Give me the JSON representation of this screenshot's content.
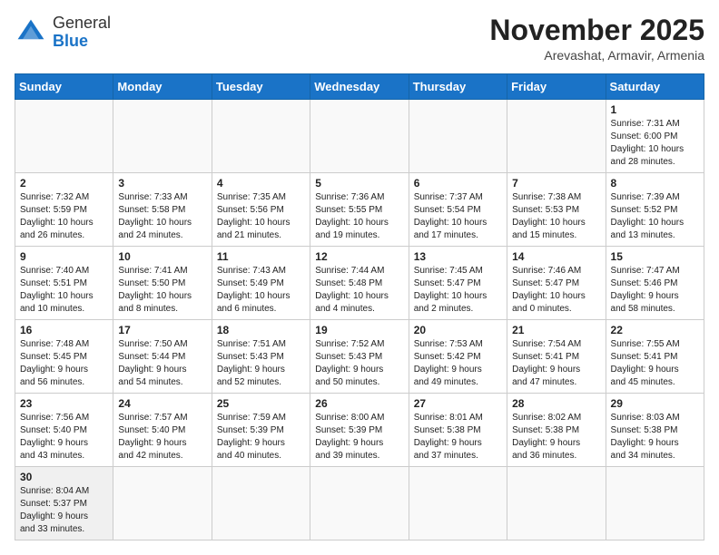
{
  "logo": {
    "text_general": "General",
    "text_blue": "Blue"
  },
  "title": "November 2025",
  "subtitle": "Arevashat, Armavir, Armenia",
  "weekdays": [
    "Sunday",
    "Monday",
    "Tuesday",
    "Wednesday",
    "Thursday",
    "Friday",
    "Saturday"
  ],
  "weeks": [
    [
      {
        "day": "",
        "info": ""
      },
      {
        "day": "",
        "info": ""
      },
      {
        "day": "",
        "info": ""
      },
      {
        "day": "",
        "info": ""
      },
      {
        "day": "",
        "info": ""
      },
      {
        "day": "",
        "info": ""
      },
      {
        "day": "1",
        "info": "Sunrise: 7:31 AM\nSunset: 6:00 PM\nDaylight: 10 hours\nand 28 minutes."
      }
    ],
    [
      {
        "day": "2",
        "info": "Sunrise: 7:32 AM\nSunset: 5:59 PM\nDaylight: 10 hours\nand 26 minutes."
      },
      {
        "day": "3",
        "info": "Sunrise: 7:33 AM\nSunset: 5:58 PM\nDaylight: 10 hours\nand 24 minutes."
      },
      {
        "day": "4",
        "info": "Sunrise: 7:35 AM\nSunset: 5:56 PM\nDaylight: 10 hours\nand 21 minutes."
      },
      {
        "day": "5",
        "info": "Sunrise: 7:36 AM\nSunset: 5:55 PM\nDaylight: 10 hours\nand 19 minutes."
      },
      {
        "day": "6",
        "info": "Sunrise: 7:37 AM\nSunset: 5:54 PM\nDaylight: 10 hours\nand 17 minutes."
      },
      {
        "day": "7",
        "info": "Sunrise: 7:38 AM\nSunset: 5:53 PM\nDaylight: 10 hours\nand 15 minutes."
      },
      {
        "day": "8",
        "info": "Sunrise: 7:39 AM\nSunset: 5:52 PM\nDaylight: 10 hours\nand 13 minutes."
      }
    ],
    [
      {
        "day": "9",
        "info": "Sunrise: 7:40 AM\nSunset: 5:51 PM\nDaylight: 10 hours\nand 10 minutes."
      },
      {
        "day": "10",
        "info": "Sunrise: 7:41 AM\nSunset: 5:50 PM\nDaylight: 10 hours\nand 8 minutes."
      },
      {
        "day": "11",
        "info": "Sunrise: 7:43 AM\nSunset: 5:49 PM\nDaylight: 10 hours\nand 6 minutes."
      },
      {
        "day": "12",
        "info": "Sunrise: 7:44 AM\nSunset: 5:48 PM\nDaylight: 10 hours\nand 4 minutes."
      },
      {
        "day": "13",
        "info": "Sunrise: 7:45 AM\nSunset: 5:47 PM\nDaylight: 10 hours\nand 2 minutes."
      },
      {
        "day": "14",
        "info": "Sunrise: 7:46 AM\nSunset: 5:47 PM\nDaylight: 10 hours\nand 0 minutes."
      },
      {
        "day": "15",
        "info": "Sunrise: 7:47 AM\nSunset: 5:46 PM\nDaylight: 9 hours\nand 58 minutes."
      }
    ],
    [
      {
        "day": "16",
        "info": "Sunrise: 7:48 AM\nSunset: 5:45 PM\nDaylight: 9 hours\nand 56 minutes."
      },
      {
        "day": "17",
        "info": "Sunrise: 7:50 AM\nSunset: 5:44 PM\nDaylight: 9 hours\nand 54 minutes."
      },
      {
        "day": "18",
        "info": "Sunrise: 7:51 AM\nSunset: 5:43 PM\nDaylight: 9 hours\nand 52 minutes."
      },
      {
        "day": "19",
        "info": "Sunrise: 7:52 AM\nSunset: 5:43 PM\nDaylight: 9 hours\nand 50 minutes."
      },
      {
        "day": "20",
        "info": "Sunrise: 7:53 AM\nSunset: 5:42 PM\nDaylight: 9 hours\nand 49 minutes."
      },
      {
        "day": "21",
        "info": "Sunrise: 7:54 AM\nSunset: 5:41 PM\nDaylight: 9 hours\nand 47 minutes."
      },
      {
        "day": "22",
        "info": "Sunrise: 7:55 AM\nSunset: 5:41 PM\nDaylight: 9 hours\nand 45 minutes."
      }
    ],
    [
      {
        "day": "23",
        "info": "Sunrise: 7:56 AM\nSunset: 5:40 PM\nDaylight: 9 hours\nand 43 minutes."
      },
      {
        "day": "24",
        "info": "Sunrise: 7:57 AM\nSunset: 5:40 PM\nDaylight: 9 hours\nand 42 minutes."
      },
      {
        "day": "25",
        "info": "Sunrise: 7:59 AM\nSunset: 5:39 PM\nDaylight: 9 hours\nand 40 minutes."
      },
      {
        "day": "26",
        "info": "Sunrise: 8:00 AM\nSunset: 5:39 PM\nDaylight: 9 hours\nand 39 minutes."
      },
      {
        "day": "27",
        "info": "Sunrise: 8:01 AM\nSunset: 5:38 PM\nDaylight: 9 hours\nand 37 minutes."
      },
      {
        "day": "28",
        "info": "Sunrise: 8:02 AM\nSunset: 5:38 PM\nDaylight: 9 hours\nand 36 minutes."
      },
      {
        "day": "29",
        "info": "Sunrise: 8:03 AM\nSunset: 5:38 PM\nDaylight: 9 hours\nand 34 minutes."
      }
    ],
    [
      {
        "day": "30",
        "info": "Sunrise: 8:04 AM\nSunset: 5:37 PM\nDaylight: 9 hours\nand 33 minutes."
      },
      {
        "day": "",
        "info": ""
      },
      {
        "day": "",
        "info": ""
      },
      {
        "day": "",
        "info": ""
      },
      {
        "day": "",
        "info": ""
      },
      {
        "day": "",
        "info": ""
      },
      {
        "day": "",
        "info": ""
      }
    ]
  ]
}
